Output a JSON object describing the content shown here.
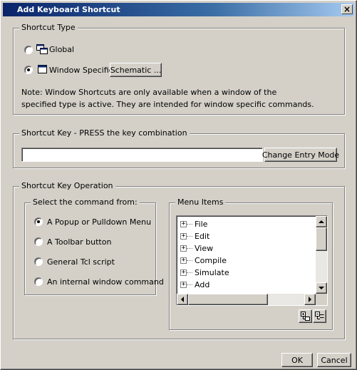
{
  "window": {
    "title": "Add Keyboard Shortcut",
    "close_glyph": "×"
  },
  "shortcut_type": {
    "legend": "Shortcut Type",
    "global_label": "Global",
    "window_specific_label": "Window Specific:",
    "selected": "window_specific",
    "schematic_button": "Schematic ...",
    "note_line1": "Note: Window Shortcuts are only available when a window of the",
    "note_line2": "specified type is active. They are intended for window specific commands."
  },
  "shortcut_key": {
    "legend": "Shortcut Key - PRESS the key combination",
    "value": "",
    "change_mode_button": "Change Entry Mode"
  },
  "operation": {
    "legend": "Shortcut Key Operation",
    "select_from": {
      "legend": "Select the command from:",
      "options": [
        {
          "label": "A Popup or Pulldown Menu",
          "checked": true
        },
        {
          "label": "A Toolbar button",
          "checked": false
        },
        {
          "label": "General Tcl script",
          "checked": false
        },
        {
          "label": "An internal window command",
          "checked": false
        }
      ]
    },
    "menu_items": {
      "legend": "Menu Items",
      "items": [
        {
          "label": "File",
          "expander": "+"
        },
        {
          "label": "Edit",
          "expander": "+"
        },
        {
          "label": "View",
          "expander": "+"
        },
        {
          "label": "Compile",
          "expander": "+"
        },
        {
          "label": "Simulate",
          "expander": "+"
        },
        {
          "label": "Add",
          "expander": "+"
        }
      ]
    }
  },
  "footer": {
    "ok_button": "OK",
    "cancel_button": "Cancel"
  },
  "colors": {
    "titlebar_start": "#0a246a",
    "titlebar_end": "#a6caf0",
    "face": "#d4d0c8"
  }
}
